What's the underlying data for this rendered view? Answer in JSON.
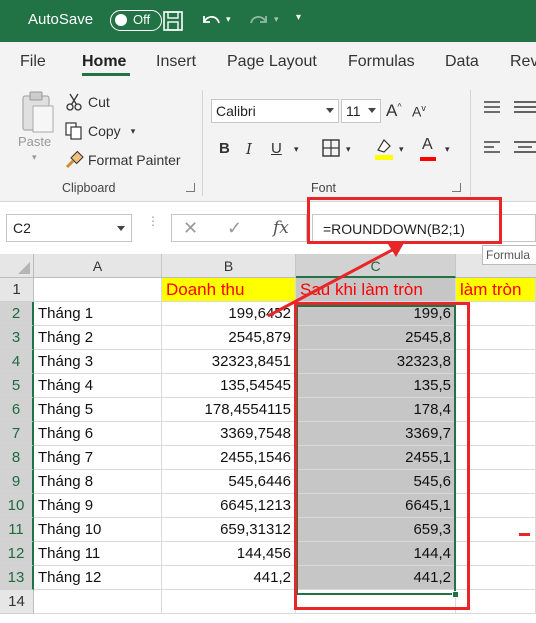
{
  "titlebar": {
    "autosave_label": "AutoSave",
    "autosave_state": "Off"
  },
  "tabs": [
    {
      "label": "File",
      "active": false
    },
    {
      "label": "Home",
      "active": true
    },
    {
      "label": "Insert",
      "active": false
    },
    {
      "label": "Page Layout",
      "active": false
    },
    {
      "label": "Formulas",
      "active": false
    },
    {
      "label": "Data",
      "active": false
    },
    {
      "label": "Revi",
      "active": false
    }
  ],
  "ribbon": {
    "clipboard": {
      "group_label": "Clipboard",
      "paste_label": "Paste",
      "cut_label": "Cut",
      "copy_label": "Copy",
      "format_painter_label": "Format Painter"
    },
    "font": {
      "group_label": "Font",
      "font_name": "Calibri",
      "font_size": "11",
      "bold": "B",
      "italic": "I",
      "underline": "U",
      "grow": "A",
      "shrink": "A",
      "font_color_letter": "A",
      "highlight_color": "#ffff00",
      "font_color": "#ff0000"
    }
  },
  "formula_bar": {
    "name_box": "C2",
    "formula": "=ROUNDDOWN(B2;1)",
    "fx_label": "fx",
    "tooltip": "Formula"
  },
  "sheet": {
    "columns": [
      "A",
      "B",
      "C"
    ],
    "selected_column": "C",
    "rows": [
      "1",
      "2",
      "3",
      "4",
      "5",
      "6",
      "7",
      "8",
      "9",
      "10",
      "11",
      "12",
      "13",
      "14"
    ],
    "header": {
      "b": "Doanh thu",
      "c": "Sau khi làm tròn",
      "d": "làm tròn"
    },
    "data": [
      {
        "a": "Tháng 1",
        "b": "199,6452",
        "c": "199,6"
      },
      {
        "a": "Tháng 2",
        "b": "2545,879",
        "c": "2545,8"
      },
      {
        "a": "Tháng 3",
        "b": "32323,8451",
        "c": "32323,8"
      },
      {
        "a": "Tháng 4",
        "b": "135,54545",
        "c": "135,5"
      },
      {
        "a": "Tháng 5",
        "b": "178,4554115",
        "c": "178,4"
      },
      {
        "a": "Tháng 6",
        "b": "3369,7548",
        "c": "3369,7"
      },
      {
        "a": "Tháng 7",
        "b": "2455,1546",
        "c": "2455,1"
      },
      {
        "a": "Tháng 8",
        "b": "545,6446",
        "c": "545,6"
      },
      {
        "a": "Tháng 9",
        "b": "6645,1213",
        "c": "6645,1"
      },
      {
        "a": "Tháng 10",
        "b": "659,31312",
        "c": "659,3"
      },
      {
        "a": "Tháng 11",
        "b": "144,456",
        "c": "144,4"
      },
      {
        "a": "Tháng 12",
        "b": "441,2",
        "c": "441,2"
      }
    ]
  },
  "colors": {
    "brand_green": "#217346",
    "annotation_red": "#e8262a",
    "header_fill": "#ffff00",
    "header_text": "#ff0000",
    "selection_fill": "#c6c6c6"
  }
}
